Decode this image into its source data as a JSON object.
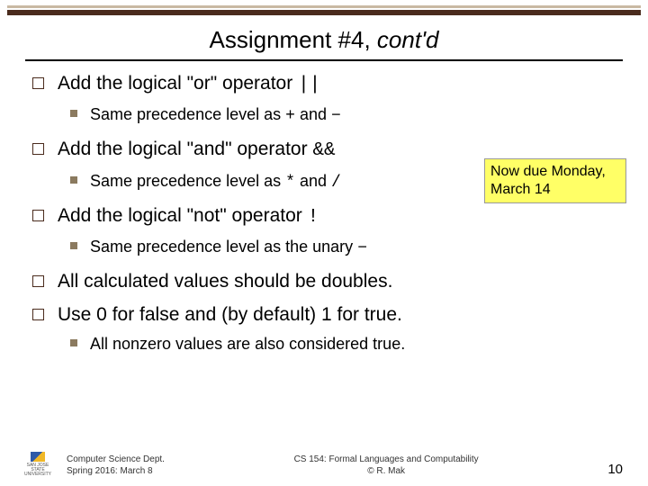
{
  "title": {
    "main": "Assignment #4, ",
    "italic": "cont'd"
  },
  "bullets": {
    "b1": {
      "text_a": "Add the logical \"or\" operator ",
      "op": "||",
      "sub_a": "Same precedence level as ",
      "sub_op1": "+",
      "sub_mid": " and ",
      "sub_op2": "−"
    },
    "b2": {
      "text_a": "Add the logical \"and\" operator ",
      "op": "&&",
      "sub_a": "Same precedence level as ",
      "sub_op1": "*",
      "sub_mid": " and ",
      "sub_op2": "/"
    },
    "b3": {
      "text_a": "Add the logical \"not\" operator ",
      "op": "!",
      "sub_a": "Same precedence level as the unary ",
      "sub_op1": "−"
    },
    "b4": {
      "text": "All calculated values should be doubles."
    },
    "b5": {
      "text": "Use 0 for false and (by default) 1 for true.",
      "sub": "All nonzero values are also considered true."
    }
  },
  "callout": {
    "line1": "Now due Monday,",
    "line2": "March 14"
  },
  "footer": {
    "logo_text": "SAN JOSE STATE UNIVERSITY",
    "left1": "Computer Science Dept.",
    "left2": "Spring 2016: March 8",
    "center1": "CS 154: Formal Languages and Computability",
    "center2": "© R. Mak",
    "page": "10"
  }
}
